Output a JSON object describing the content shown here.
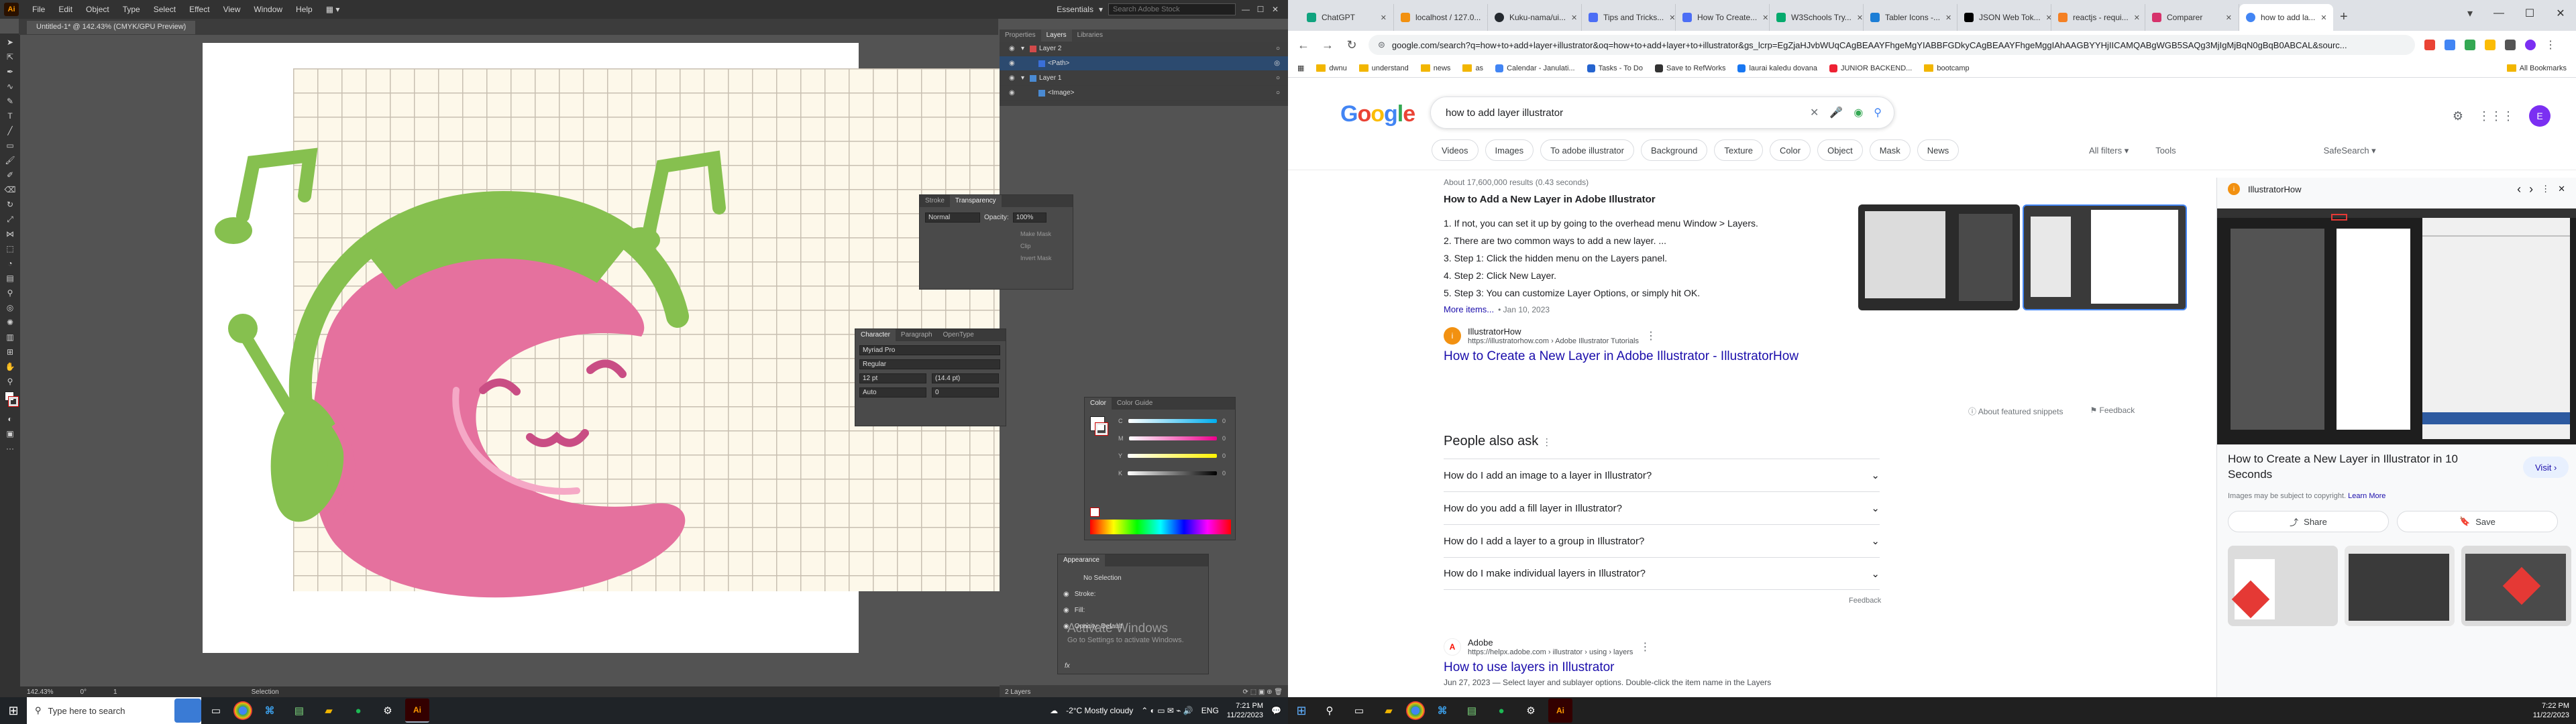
{
  "illustrator": {
    "logo": "Ai",
    "menus": [
      "File",
      "Edit",
      "Object",
      "Type",
      "Select",
      "Effect",
      "View",
      "Window",
      "Help"
    ],
    "workspace": "Essentials",
    "stock_placeholder": "Search Adobe Stock",
    "doc_tab": "Untitled-1* @ 142.43% (CMYK/GPU Preview)",
    "panel_tabs": [
      "Properties",
      "Layers",
      "Libraries"
    ],
    "layers": [
      {
        "name": "Layer 2",
        "swatch": "#d24a4a",
        "selected": false,
        "indent": 0
      },
      {
        "name": "<Path>",
        "swatch": "#3a6fd8",
        "selected": true,
        "indent": 1
      },
      {
        "name": "Layer 1",
        "swatch": "#4a8ad2",
        "selected": false,
        "indent": 0
      },
      {
        "name": "<Image>",
        "swatch": "#4a8ad2",
        "selected": false,
        "indent": 1
      }
    ],
    "layers_count": "2 Layers",
    "transparency": {
      "tabs": [
        "Stroke",
        "Transparency"
      ],
      "blend": "Normal",
      "opacity_label": "Opacity:",
      "opacity": "100%",
      "options": [
        "Make Mask",
        "Clip",
        "Invert Mask"
      ]
    },
    "character": {
      "tabs": [
        "Character",
        "Paragraph",
        "OpenType"
      ],
      "font": "Myriad Pro",
      "style": "Regular",
      "size": "12 pt",
      "leading": "(14.4 pt)",
      "tracking": "Auto",
      "kerning": "0"
    },
    "color": {
      "tabs": [
        "Color",
        "Color Guide"
      ],
      "values": [
        "0",
        "0",
        "0",
        "0"
      ]
    },
    "appearance": {
      "title": "Appearance",
      "selection": "No Selection",
      "rows": [
        "Stroke:",
        "Fill:",
        "Opacity: Default"
      ],
      "fx": "fx"
    },
    "activate": {
      "line1": "Activate Windows",
      "line2": "Go to Settings to activate Windows."
    },
    "status": {
      "zoom": "142.43%",
      "angle": "0°",
      "page": "1",
      "tool": "Selection"
    }
  },
  "chrome": {
    "tabs": [
      {
        "title": "ChatGPT",
        "color": "#10a37f"
      },
      {
        "title": "localhost / 127.0...",
        "color": "#f29111"
      },
      {
        "title": "Kuku-nama/ui...",
        "color": "#24292f"
      },
      {
        "title": "Tips and Tricks...",
        "color": "#4c6ef5"
      },
      {
        "title": "How To Create...",
        "color": "#4c6ef5"
      },
      {
        "title": "W3Schools Try...",
        "color": "#04aa6d"
      },
      {
        "title": "Tabler Icons -...",
        "color": "#1c7ed6"
      },
      {
        "title": "JSON Web Tok...",
        "color": "#000000"
      },
      {
        "title": "reactjs - requi...",
        "color": "#f48024"
      },
      {
        "title": "Comparer",
        "color": "#d6336c"
      },
      {
        "title": "how to add la...",
        "color": "#4285f4"
      }
    ],
    "url": "google.com/search?q=how+to+add+layer+illustrator&oq=how+to+add+layer+to+illustrator&gs_lcrp=EgZjaHJvbWUqCAgBEAAYFhgeMgYIABBFGDkyCAgBEAAYFhgeMggIAhAAGBYYHjIICAMQABgWGB5SAQg3MjIgMjBqN0gBqB0ABCAL&sourc...",
    "bookmarks": [
      "dwnu",
      "understand",
      "news",
      "as",
      "Calendar - Janulati...",
      "Tasks - To Do",
      "Save to RefWorks",
      "laurai kaledu dovana",
      "JUNIOR BACKEND...",
      "bootcamp"
    ],
    "all_bookmarks": "All Bookmarks"
  },
  "google": {
    "logo": "Google",
    "query": "how to add layer illustrator",
    "chips": [
      "Videos",
      "Images",
      "To adobe illustrator",
      "Background",
      "Texture",
      "Color",
      "Object",
      "Mask",
      "News"
    ],
    "all_filters": "All filters",
    "tools": "Tools",
    "safesearch": "SafeSearch",
    "results_count": "About 17,600,000 results (0.43 seconds)",
    "snippet_title": "How to Add a New Layer in Adobe Illustrator",
    "steps": [
      "1. If not, you can set it up by going to the overhead menu Window > Layers.",
      "2. There are two common ways to add a new layer. ...",
      "3. Step 1: Click the hidden menu on the Layers panel.",
      "4. Step 2: Click New Layer.",
      "5. Step 3: You can customize Layer Options, or simply hit OK."
    ],
    "more_items": "More items...",
    "date": "• Jan 10, 2023",
    "source_name": "IllustratorHow",
    "source_url": "https://illustratorhow.com › Adobe Illustrator Tutorials",
    "result_link": "How to Create a New Layer in Adobe Illustrator - IllustratorHow",
    "about_snippets": "About featured snippets",
    "feedback": "Feedback",
    "paa_title": "People also ask",
    "paa": [
      "How do I add an image to a layer in Illustrator?",
      "How do you add a fill layer in Illustrator?",
      "How do I add a layer to a group in Illustrator?",
      "How do I make individual layers in Illustrator?"
    ],
    "adobe_name": "Adobe",
    "adobe_url": "https://helpx.adobe.com › illustrator › using › layers",
    "adobe_link": "How to use layers in Illustrator",
    "adobe_snippet": "Jun 27, 2023 — Select layer and sublayer options. Double-click the item name in the Layers"
  },
  "side_panel": {
    "site": "IllustratorHow",
    "title": "How to Create a New Layer in Illustrator in 10 Seconds",
    "visit": "Visit",
    "copyright": "Images may be subject to copyright.",
    "learn_more": "Learn More",
    "share": "Share",
    "save": "Save"
  },
  "taskbar": {
    "search_placeholder": "Type here to search",
    "weather": "-2°C  Mostly cloudy",
    "lang": "ENG",
    "left_time": "7:21 PM",
    "left_date": "11/22/2023",
    "right_time": "7:22 PM",
    "right_date": "11/22/2023"
  }
}
